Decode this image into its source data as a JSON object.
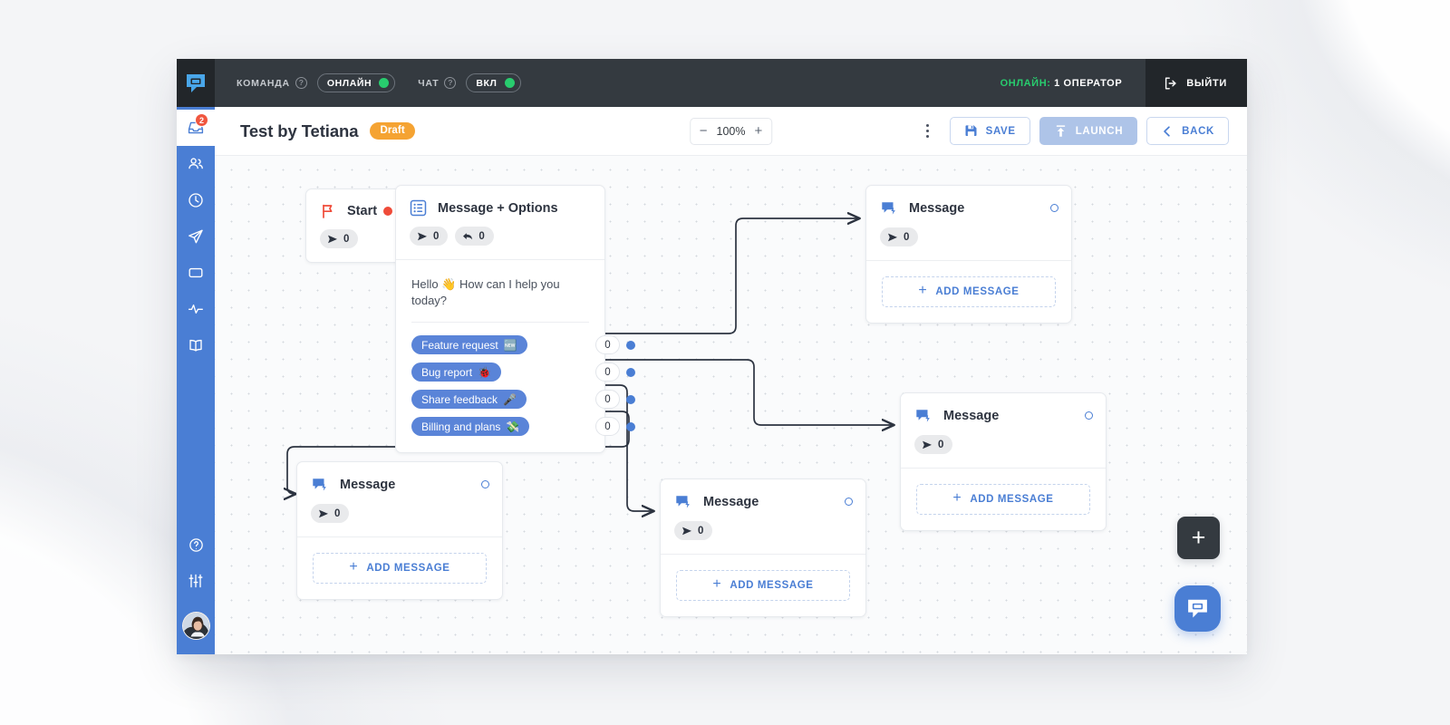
{
  "topbar": {
    "brand_icon": "chat-logo-icon",
    "team_label": "КОМАНДА",
    "team_status": "ОНЛАЙН",
    "chat_label": "ЧАТ",
    "chat_status": "ВКЛ",
    "help_glyph": "?",
    "online_prefix": "ОНЛАЙН:",
    "online_count": "1 ОПЕРАТОР",
    "logout_label": "ВЫЙТИ",
    "accent_green": "#28cc6e",
    "bar_bg": "#343a40"
  },
  "sidebar": {
    "bg": "#4a7ed4",
    "badge_color": "#f0563f",
    "items": [
      {
        "name": "inbox",
        "label": "Inbox",
        "badge": "2",
        "active": true
      },
      {
        "name": "contacts",
        "label": "Contacts",
        "badge": "",
        "active": false
      },
      {
        "name": "history",
        "label": "History",
        "badge": "",
        "active": false
      },
      {
        "name": "campaigns",
        "label": "Campaigns",
        "badge": "",
        "active": false
      },
      {
        "name": "widgets",
        "label": "Widgets",
        "badge": "",
        "active": false
      },
      {
        "name": "analytics",
        "label": "Analytics",
        "badge": "",
        "active": false
      },
      {
        "name": "knowledge-base",
        "label": "Knowledge Base",
        "badge": "",
        "active": false
      }
    ],
    "bottom_items": [
      {
        "name": "help",
        "label": "Help"
      },
      {
        "name": "settings",
        "label": "Settings"
      }
    ],
    "avatar_label": "User avatar"
  },
  "toolbar": {
    "title": "Test by Tetiana",
    "status_badge": "Draft",
    "status_badge_color": "#f5a332",
    "zoom_out": "−",
    "zoom_value": "100%",
    "zoom_in": "+",
    "menu_icon": "kebab-menu-icon",
    "save_label": "SAVE",
    "launch_label": "LAUNCH",
    "back_label": "BACK",
    "accent_blue": "#4a7ed4"
  },
  "canvas": {
    "add_node_label": "+",
    "chat_widget_label": "chat-widget"
  },
  "flow": {
    "nodes": [
      {
        "id": "start",
        "type": "start",
        "title": "Start",
        "icon": "flag-icon",
        "chips": [
          {
            "icon": "send-icon",
            "value": "0"
          }
        ],
        "has_red_dot": true
      },
      {
        "id": "message-options",
        "type": "message-options",
        "title": "Message + Options",
        "icon": "list-options-icon",
        "chips": [
          {
            "icon": "send-icon",
            "value": "0"
          },
          {
            "icon": "reply-icon",
            "value": "0"
          }
        ],
        "body_text": "Hello 👋 How can I help you today?",
        "options": [
          {
            "label": "Feature request",
            "emoji": "🆕",
            "count": "0"
          },
          {
            "label": "Bug report",
            "emoji": "🐞",
            "count": "0"
          },
          {
            "label": "Share feedback",
            "emoji": "🎤",
            "count": "0"
          },
          {
            "label": "Billing and plans",
            "emoji": "💸",
            "count": "0"
          }
        ]
      },
      {
        "id": "message-top-right",
        "type": "message",
        "title": "Message",
        "icon": "message-bolt-icon",
        "chips": [
          {
            "icon": "send-icon",
            "value": "0"
          }
        ],
        "add_label": "ADD MESSAGE"
      },
      {
        "id": "message-mid-right",
        "type": "message",
        "title": "Message",
        "icon": "message-bolt-icon",
        "chips": [
          {
            "icon": "send-icon",
            "value": "0"
          }
        ],
        "add_label": "ADD MESSAGE"
      },
      {
        "id": "message-bottom-left",
        "type": "message",
        "title": "Message",
        "icon": "message-bolt-icon",
        "chips": [
          {
            "icon": "send-icon",
            "value": "0"
          }
        ],
        "add_label": "ADD MESSAGE"
      },
      {
        "id": "message-bottom-mid",
        "type": "message",
        "title": "Message",
        "icon": "message-bolt-icon",
        "chips": [
          {
            "icon": "send-icon",
            "value": "0"
          }
        ],
        "add_label": "ADD MESSAGE"
      }
    ]
  }
}
